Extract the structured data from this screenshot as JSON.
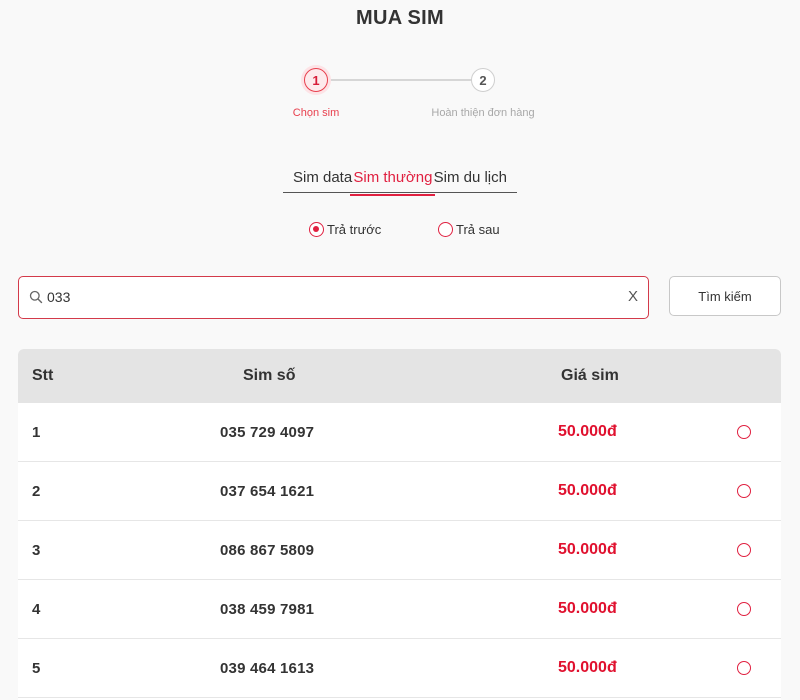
{
  "page": {
    "title": "MUA SIM"
  },
  "stepper": {
    "steps": [
      {
        "number": "1",
        "label": "Chọn sim",
        "state": "active"
      },
      {
        "number": "2",
        "label": "Hoàn thiện đơn hàng",
        "state": "inactive"
      }
    ]
  },
  "tabs": [
    {
      "label": "Sim data",
      "active": false
    },
    {
      "label": "Sim thường",
      "active": true
    },
    {
      "label": "Sim du lịch",
      "active": false
    }
  ],
  "payment_type": {
    "options": [
      {
        "label": "Trả trước",
        "checked": true
      },
      {
        "label": "Trả sau",
        "checked": false
      }
    ]
  },
  "search": {
    "value": "033",
    "clear_label": "X",
    "button_label": "Tìm kiếm"
  },
  "table": {
    "headers": {
      "stt": "Stt",
      "number": "Sim số",
      "price": "Giá sim"
    },
    "rows": [
      {
        "stt": "1",
        "number": "035 729 4097",
        "price": "50.000đ"
      },
      {
        "stt": "2",
        "number": "037 654 1621",
        "price": "50.000đ"
      },
      {
        "stt": "3",
        "number": "086 867 5809",
        "price": "50.000đ"
      },
      {
        "stt": "4",
        "number": "038 459 7981",
        "price": "50.000đ"
      },
      {
        "stt": "5",
        "number": "039 464 1613",
        "price": "50.000đ"
      }
    ]
  },
  "colors": {
    "accent": "#e02040",
    "price": "#e0102e",
    "header_bg": "#e4e4e4"
  },
  "icons": {
    "search": "search-icon",
    "clear": "close-icon",
    "select": "radio-icon"
  }
}
